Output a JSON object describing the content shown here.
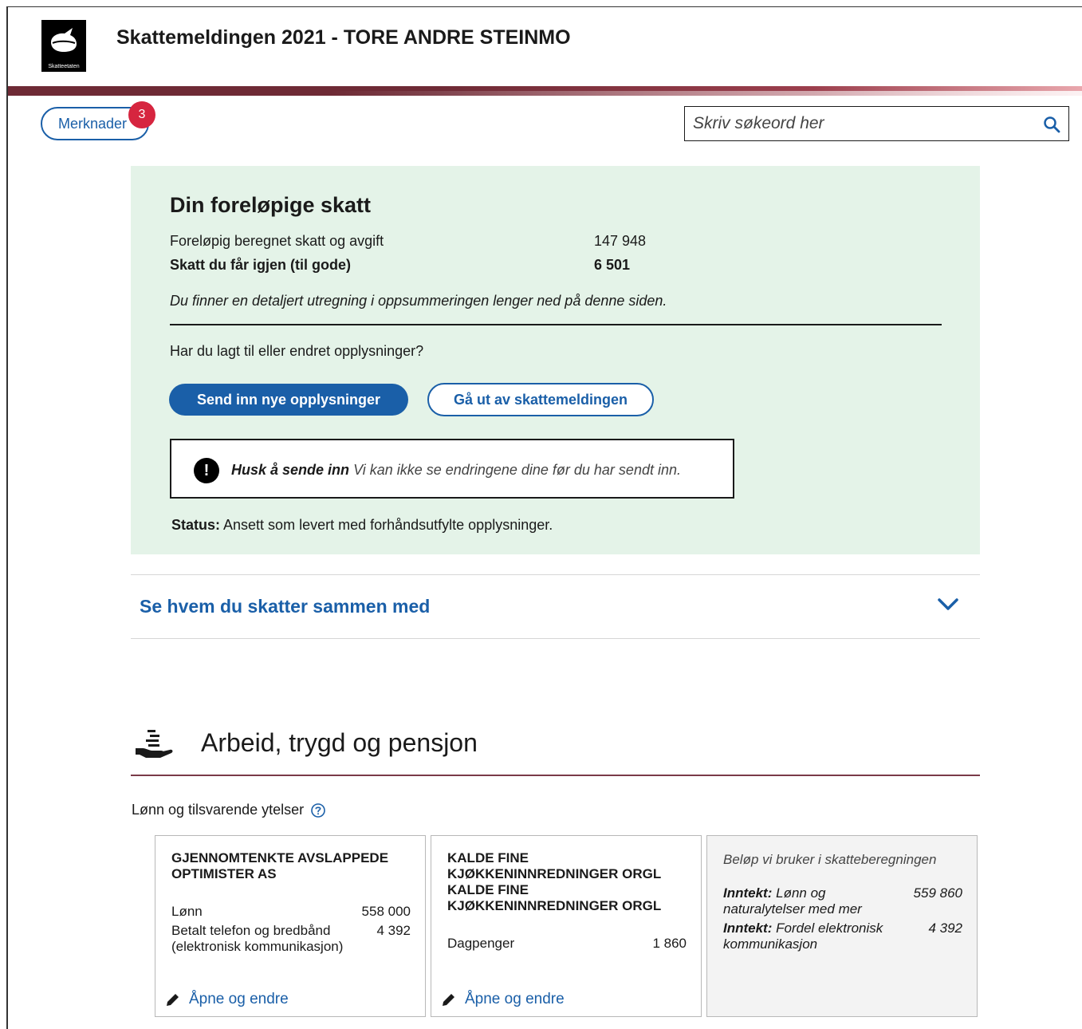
{
  "header": {
    "logo_text": "Skatteetaten",
    "title": "Skattemeldingen 2021 - TORE ANDRE STEINMO"
  },
  "toolbar": {
    "merknader_label": "Merknader",
    "merknader_count": "3",
    "search_placeholder": "Skriv søkeord her"
  },
  "summary": {
    "title": "Din foreløpige skatt",
    "rows": [
      {
        "label": "Foreløpig beregnet skatt og avgift",
        "value": "147 948"
      },
      {
        "label": "Skatt du får igjen (til gode)",
        "value": "6 501"
      }
    ],
    "note": "Du finner en detaljert utregning i oppsummeringen lenger ned på denne siden.",
    "question": "Har du lagt til eller endret opplysninger?",
    "send_button": "Send inn nye opplysninger",
    "exit_button": "Gå ut av skattemeldingen",
    "callout_bold": "Husk å sende inn",
    "callout_text": "Vi kan ikke se endringene dine før du har sendt inn.",
    "status_label": "Status:",
    "status_text": "Ansett som levert med forhåndsutfylte opplysninger."
  },
  "accordion": {
    "label": "Se hvem du skatter sammen med"
  },
  "section": {
    "title": "Arbeid, trygd og pensjon",
    "sub_label": "Lønn og tilsvarende ytelser"
  },
  "cards": [
    {
      "title": "GJENNOMTENKTE AVSLAPPEDE OPTIMISTER AS",
      "lines": [
        {
          "label": "Lønn",
          "amount": "558 000"
        },
        {
          "label": "Betalt telefon og bredbånd (elektronisk kommunikasjon)",
          "amount": "4 392"
        }
      ],
      "link": "Åpne og endre"
    },
    {
      "title": "KALDE FINE KJØKKENINNREDNINGER ORGL KALDE FINE KJØKKENINNREDNINGER ORGL",
      "lines": [
        {
          "label": "Dagpenger",
          "amount": "1 860"
        }
      ],
      "link": "Åpne og endre"
    }
  ],
  "calc_card": {
    "title": "Beløp vi bruker i skatteberegningen",
    "lines": [
      {
        "prefix": "Inntekt:",
        "label": "Lønn og naturalytelser med mer",
        "amount": "559 860"
      },
      {
        "prefix": "Inntekt:",
        "label": "Fordel elektronisk kommunikasjon",
        "amount": "4 392"
      }
    ]
  },
  "colors": {
    "accent_blue": "#1a5fa8",
    "panel_green": "#e4f3e8",
    "badge_red": "#d6253f",
    "brand_wine": "#6e2a35"
  }
}
